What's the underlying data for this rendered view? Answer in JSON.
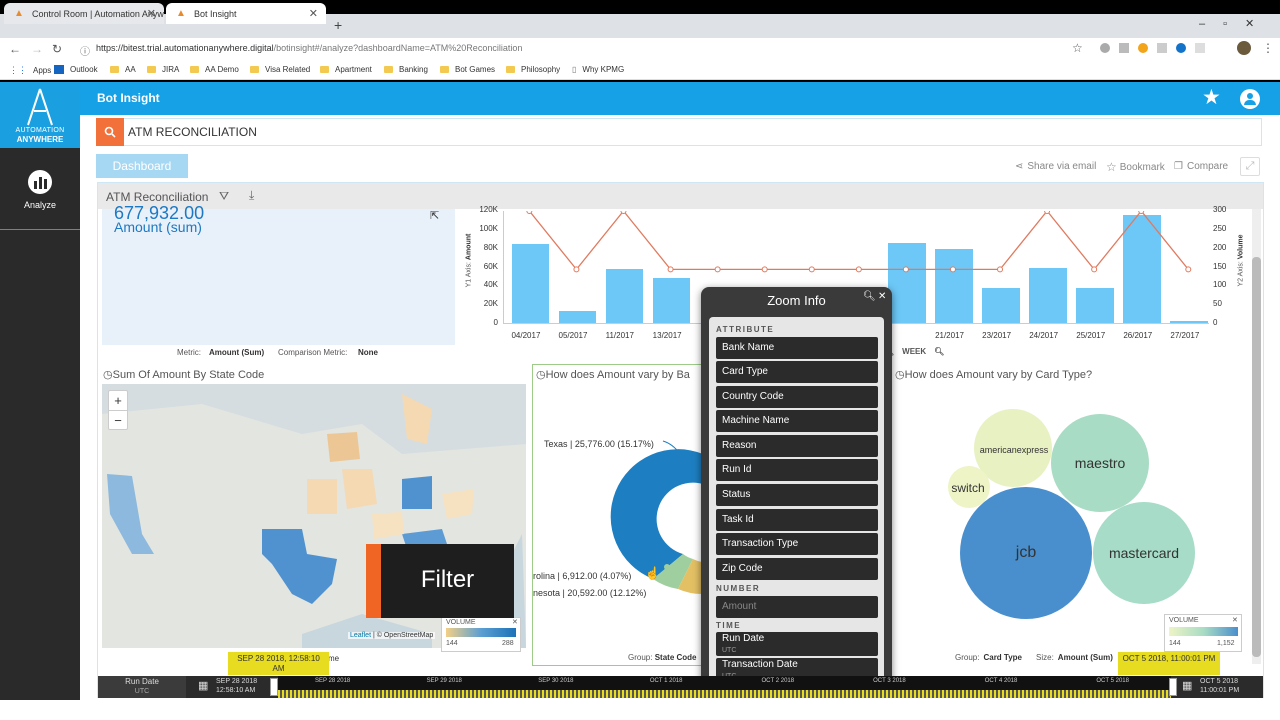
{
  "browser": {
    "tabs": [
      {
        "title": "Control Room | Automation Anyw",
        "active": false
      },
      {
        "title": "Bot Insight",
        "active": true
      }
    ],
    "url_base": "https://bitest.trial.automationanywhere.digital",
    "url_path": "/botinsight#/analyze?dashboardName=ATM%20Reconciliation",
    "bookmarks": [
      "Apps",
      "Outlook",
      "AA",
      "JIRA",
      "AA Demo",
      "Visa Related",
      "Apartment",
      "Banking",
      "Bot Games",
      "Philosophy",
      "Why KPMG"
    ]
  },
  "app": {
    "logo_line1": "AUTOMATION",
    "logo_line2": "ANYWHERE",
    "sidebar_analyze": "Analyze",
    "title": "Bot Insight",
    "search_value": "ATM RECONCILIATION",
    "dashboard_tab": "Dashboard",
    "share": "Share via email",
    "bookmark": "Bookmark",
    "compare": "Compare",
    "board_title": "ATM Reconciliation"
  },
  "kpi": {
    "value": "677,932.00",
    "label": "Amount (sum)",
    "metric_label": "Metric:",
    "metric_value": "Amount (Sum)",
    "comparison_label": "Comparison Metric:",
    "comparison_value": "None"
  },
  "chart_data": {
    "type": "bar",
    "categories": [
      "04/2017",
      "05/2017",
      "11/2017",
      "13/2017",
      "",
      "",
      "",
      "",
      "",
      "21/2017",
      "23/2017",
      "24/2017",
      "25/2017",
      "26/2017",
      "27/2017"
    ],
    "series": [
      {
        "type": "bar",
        "values": [
          84000,
          13000,
          57000,
          48000,
          0,
          0,
          0,
          0,
          85000,
          79000,
          37000,
          58000,
          37000,
          115000,
          2000
        ]
      },
      {
        "type": "line",
        "axis": "y2",
        "values": [
          300,
          145,
          300,
          145,
          145,
          145,
          145,
          145,
          145,
          145,
          145,
          300,
          145,
          300,
          145
        ]
      }
    ],
    "ylabel": "Amount",
    "y1_axis_label": "Y1 Axis:",
    "y2label": "Volume",
    "y2_axis_label": "Y2 Axis:",
    "yticks": [
      "120K",
      "100K",
      "80K",
      "60K",
      "40K",
      "20K",
      "0"
    ],
    "y2ticks": [
      "300",
      "250",
      "200",
      "150",
      "100",
      "50",
      "0"
    ],
    "ylim": [
      0,
      120000
    ],
    "y2lim": [
      0,
      300
    ],
    "week_label": "WEEK"
  },
  "map": {
    "title": "Sum Of Amount By State Code",
    "zoom_in": "+",
    "zoom_out": "−",
    "attribution_leaflet": "Leaflet",
    "attribution_osm": "| © OpenStreetMap",
    "legend_title": "VOLUME",
    "legend_min": "144",
    "legend_max": "288",
    "suffix": "me"
  },
  "donut": {
    "title": "How does Amount vary by Ba",
    "labels": [
      "Texas | 25,776.00 (15.17%)",
      "rolina | 6,912.00 (4.07%)",
      "nesota | 20,592.00 (12.12%)"
    ],
    "group_label": "Group:",
    "group_value": "State Code"
  },
  "bubble": {
    "title": "How does Amount vary by Card Type?",
    "bubbles": [
      {
        "label": "americanexpress",
        "color": "#e8f1c2"
      },
      {
        "label": "maestro",
        "color": "#a9dcc4"
      },
      {
        "label": "switch",
        "color": "#eef4c6"
      },
      {
        "label": "jcb",
        "color": "#4a8fcd"
      },
      {
        "label": "mastercard",
        "color": "#a6dcc8"
      }
    ],
    "legend_title": "VOLUME",
    "legend_min": "144",
    "legend_max": "1,152",
    "group_label": "Group:",
    "group_value": "Card Type",
    "size_label": "Size:",
    "size_value": "Amount (Sum)"
  },
  "zoom_info": {
    "title": "Zoom Info",
    "attribute_header": "ATTRIBUTE",
    "attributes": [
      "Bank Name",
      "Card Type",
      "Country Code",
      "Machine Name",
      "Reason",
      "Run Id",
      "Status",
      "Task Id",
      "Transaction Type",
      "Zip Code"
    ],
    "number_header": "NUMBER",
    "number_item": "Amount",
    "time_header": "TIME",
    "time_items": [
      {
        "label": "Run Date",
        "sub": "UTC"
      },
      {
        "label": "Transaction Date",
        "sub": "UTC"
      }
    ]
  },
  "filter_overlay": {
    "label": "Filter"
  },
  "timeline": {
    "label": "Run Date",
    "label_sub": "UTC",
    "start_date": "SEP 28 2018",
    "start_time": "12:58:10 AM",
    "start_flag": "SEP 28 2018, 12:58:10 AM",
    "end_flag": "OCT 5 2018, 11:00:01 PM",
    "end_date": "OCT 5 2018",
    "end_time": "11:00:01 PM",
    "ticks": [
      "SEP 28 2018",
      "SEP 29 2018",
      "SEP 30 2018",
      "OCT 1 2018",
      "OCT 2 2018",
      "OCT 3 2018",
      "OCT 4 2018",
      "OCT 5 2018"
    ]
  },
  "colors": {
    "brand": "#16a0e6",
    "accent": "#f2703a",
    "bar": "#6dc8f7",
    "line": "#e07a5f",
    "timeline": "#e7dc20"
  }
}
